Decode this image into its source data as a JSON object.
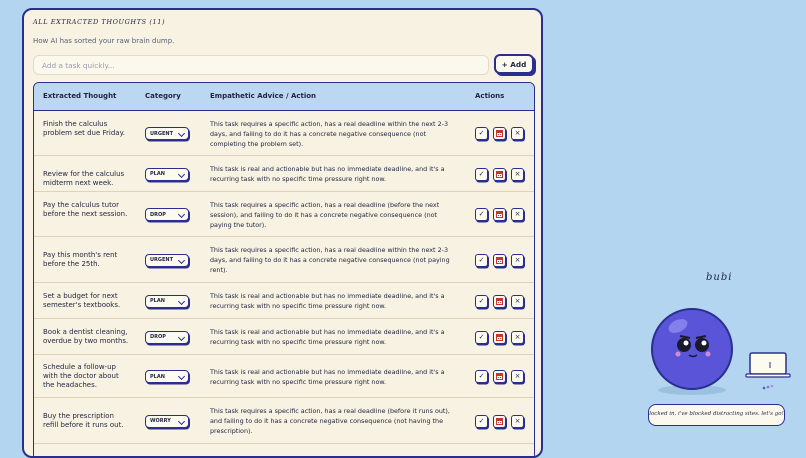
{
  "panel": {
    "title": "ALL EXTRACTED THOUGHTS (11)",
    "subtitle": "How AI has sorted your raw brain dump.",
    "quick_add_placeholder": "Add a task quickly...",
    "add_button": "+ Add"
  },
  "table": {
    "headers": {
      "thought": "Extracted Thought",
      "category": "Category",
      "advice": "Empathetic Advice / Action",
      "actions": "Actions"
    },
    "rows": [
      {
        "thought": "Finish the calculus problem set due Friday.",
        "category": "URGENT",
        "advice": "This task requires a specific action, has a real deadline within the next 2-3 days, and failing to do it has a concrete negative consequence (not completing the problem set)."
      },
      {
        "thought": "Review for the calculus midterm next week.",
        "category": "PLAN",
        "advice": "This task is real and actionable but has no immediate deadline, and it's a recurring task with no specific time pressure right now."
      },
      {
        "thought": "Pay the calculus tutor before the next session.",
        "category": "DROP",
        "advice": "This task requires a specific action, has a real deadline (before the next session), and failing to do it has a concrete negative consequence (not paying the tutor)."
      },
      {
        "thought": "Pay this month's rent before the 25th.",
        "category": "URGENT",
        "advice": "This task requires a specific action, has a real deadline within the next 2-3 days, and failing to do it has a concrete negative consequence (not paying rent)."
      },
      {
        "thought": "Set a budget for next semester's textbooks.",
        "category": "PLAN",
        "advice": "This task is real and actionable but has no immediate deadline, and it's a recurring task with no specific time pressure right now."
      },
      {
        "thought": "Book a dentist cleaning, overdue by two months.",
        "category": "DROP",
        "advice": "This task is real and actionable but has no immediate deadline, and it's a recurring task with no specific time pressure right now."
      },
      {
        "thought": "Schedule a follow-up with the doctor about the headaches.",
        "category": "PLAN",
        "advice": "This task is real and actionable but has no immediate deadline, and it's a recurring task with no specific time pressure right now."
      },
      {
        "thought": "Buy the prescription refill before it runs out.",
        "category": "WORRY",
        "advice": "This task requires a specific action, has a real deadline (before it runs out), and failing to do it has a concrete negative consequence (not having the prescription)."
      }
    ],
    "action_icons": {
      "accept": "✓",
      "schedule": "calendar-icon",
      "remove": "×"
    }
  },
  "mascot": {
    "name": "bubi",
    "speech": "locked in. i've blocked distracting sites. let's go!"
  },
  "colors": {
    "background": "#b3d5f0",
    "panel": "#f7f2e1",
    "accent": "#2a2f8f",
    "header": "#bcd7f1",
    "mascot": "#5a55d8"
  }
}
